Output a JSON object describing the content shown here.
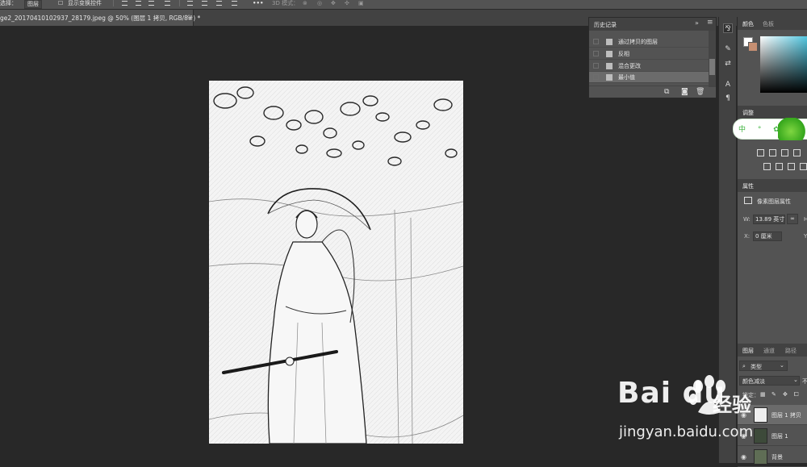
{
  "options_bar": {
    "select_label": "选择：",
    "select_value": "图层",
    "show_transform_label": "显示变换控件",
    "mode_3d_label": "3D 模式："
  },
  "document_tab": {
    "title": "ge2_20170410102937_28179.jpeg @ 50% (图层 1 拷贝, RGB/8#) *",
    "close": "×"
  },
  "history_panel": {
    "title": "历史记录",
    "collapse": "»",
    "menu": "≡",
    "items": [
      {
        "label": "通过拷贝的图层"
      },
      {
        "label": "反相"
      },
      {
        "label": "混合更改"
      },
      {
        "label": "最小值"
      }
    ],
    "footer_icons": [
      "new-document-from-state-icon",
      "snapshot-icon",
      "trash-icon"
    ]
  },
  "tool_strip": {
    "icons": [
      "history-brush-icon",
      "brush-icon",
      "adjust-icon",
      "character-icon",
      "paragraph-icon"
    ]
  },
  "color_panel": {
    "tabs": [
      "颜色",
      "色板"
    ],
    "foreground": "#ffffff",
    "background": "#c68f72"
  },
  "adjustments_panel": {
    "tab": "调整",
    "ad_text": "中 ° ✿"
  },
  "properties_panel": {
    "tab": "属性",
    "kind_label": "像素图层属性",
    "w_label": "W:",
    "w_value": "13.89 英寸",
    "h_label": "H",
    "x_label": "X:",
    "x_value": "0 厘米",
    "y_label": "Y"
  },
  "layers_panel": {
    "tabs": [
      "图层",
      "通道",
      "路径"
    ],
    "filter_label": "类型",
    "blend_mode": "颜色减淡",
    "opacity_label": "不",
    "lock_label": "锁定：",
    "layers": [
      {
        "name": "图层 1 拷贝"
      },
      {
        "name": "图层 1"
      },
      {
        "name": "背景"
      }
    ]
  },
  "watermark": {
    "logo": "Bai  du",
    "text": "经验",
    "url": "jingyan.baidu.com"
  }
}
